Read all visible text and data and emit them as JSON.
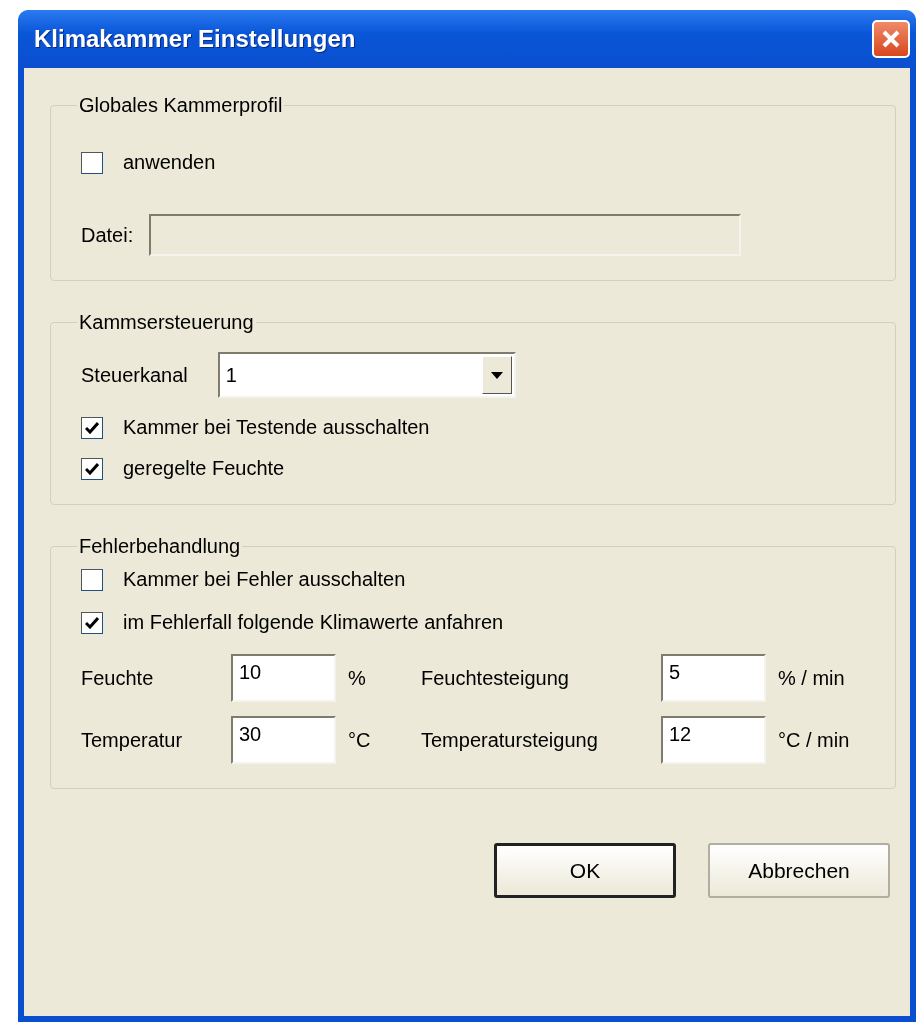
{
  "window": {
    "title": "Klimakammer Einstellungen"
  },
  "groups": [
    {
      "title": "Globales Kammerprofil",
      "items": [
        {
          "kind": "checkbox",
          "label": "anwenden",
          "checked": false
        },
        {
          "kind": "file",
          "label": "Datei:",
          "disabled": true
        }
      ]
    },
    {
      "title": "Kammsersteuerung",
      "items": [
        {
          "kind": "dropdown",
          "label": "Steuerkanal",
          "value": "1"
        },
        {
          "kind": "checkbox",
          "label": "Kammer bei Testende ausschalten",
          "checked": true
        },
        {
          "kind": "checkbox",
          "label": "geregelte Feuchte",
          "checked": true
        }
      ]
    },
    {
      "title": "Fehlerbehandlung",
      "items": [
        {
          "kind": "checkbox",
          "label": "Kammer bei Fehler ausschalten",
          "checked": false
        },
        {
          "kind": "checkbox",
          "label": "im Fehlerfall folgende Klimawerte anfahren",
          "checked": true
        },
        {
          "kind": "grid",
          "fields": [
            {
              "label": "Feuchte",
              "value": "10",
              "unit": "%"
            },
            {
              "label": "Feuchtesteigung",
              "value": "5",
              "unit": "% / min"
            },
            {
              "label": "Temperatur",
              "value": "30",
              "unit": "°C"
            },
            {
              "label": "Temperatursteigung",
              "value": "12",
              "unit": "°C / min"
            }
          ]
        }
      ]
    }
  ],
  "buttons": [
    {
      "label": "OK",
      "default": true
    },
    {
      "label": "Abbrechen",
      "default": false
    }
  ]
}
